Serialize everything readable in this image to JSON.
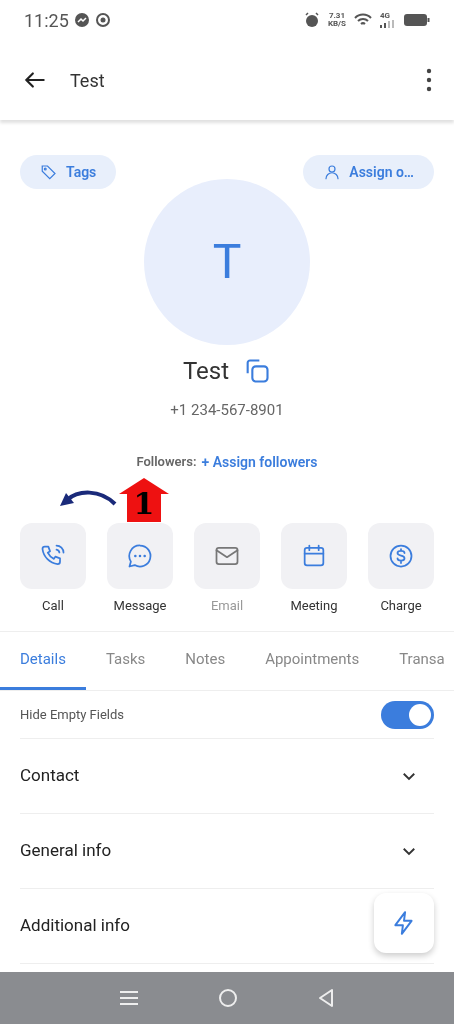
{
  "status_bar": {
    "time": "11:25",
    "speed": "7.31",
    "speed_unit": "KB/S",
    "network": "4G"
  },
  "app_bar": {
    "title": "Test"
  },
  "chips": [
    {
      "kind": "tag",
      "label": "Tags"
    },
    {
      "kind": "person",
      "label": "Assign o…"
    }
  ],
  "contact": {
    "initial": "T",
    "name": "Test",
    "phone": "+1 234-567-8901",
    "followers_label": "Followers:",
    "followers_link": "+ Assign followers"
  },
  "annotation": {
    "number": "1"
  },
  "actions": [
    {
      "kind": "call",
      "label": "Call",
      "disabled": false
    },
    {
      "kind": "message",
      "label": "Message",
      "disabled": false
    },
    {
      "kind": "email",
      "label": "Email",
      "disabled": true
    },
    {
      "kind": "meeting",
      "label": "Meeting",
      "disabled": false
    },
    {
      "kind": "charge",
      "label": "Charge",
      "disabled": false
    }
  ],
  "tabs": [
    {
      "label": "Details",
      "selected": true
    },
    {
      "label": "Tasks",
      "selected": false
    },
    {
      "label": "Notes",
      "selected": false
    },
    {
      "label": "Appointments",
      "selected": false
    },
    {
      "label": "Transa",
      "selected": false
    }
  ],
  "hide_empty": {
    "label": "Hide Empty Fields",
    "on": true
  },
  "sections": [
    {
      "label": "Contact",
      "expanded": false
    },
    {
      "label": "General info",
      "expanded": false
    },
    {
      "label": "Additional info"
    }
  ]
}
